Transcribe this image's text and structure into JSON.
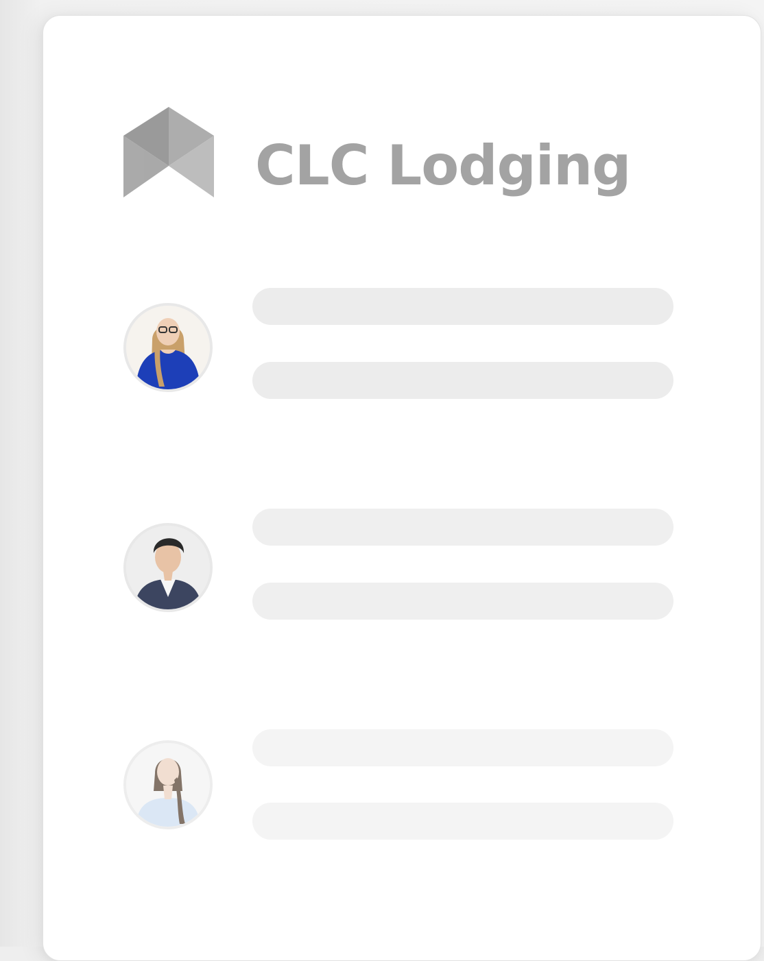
{
  "app": {
    "brand_name": "CLC Lodging",
    "logo_icon": "house-roof-logo-icon"
  },
  "contacts": [
    {
      "avatar_icon": "woman-glasses-blue-dress-avatar"
    },
    {
      "avatar_icon": "man-suit-avatar"
    },
    {
      "avatar_icon": "woman-braid-avatar"
    }
  ],
  "colors": {
    "brand_text": "#a3a3a3",
    "logo_dark": "#8c8c8c",
    "logo_light": "#b5b5b5",
    "placeholder_bar": "#ececec",
    "card_bg": "#ffffff"
  }
}
